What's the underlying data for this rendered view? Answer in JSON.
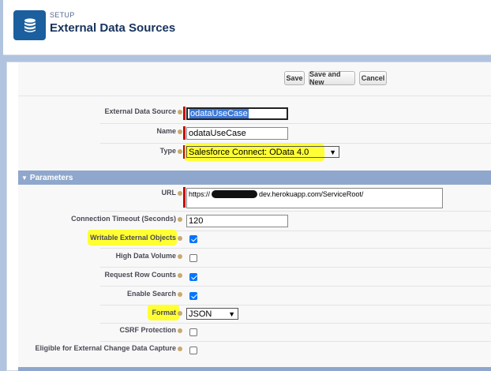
{
  "header": {
    "setup_label": "SETUP",
    "title": "External Data Sources",
    "icon": "database-icon",
    "icon_color": "#1b5f9e"
  },
  "toolbar": {
    "save": "Save",
    "save_and_new": "Save and New",
    "cancel": "Cancel"
  },
  "fields": {
    "external_data_source": {
      "label": "External Data Source",
      "value": "odataUseCase"
    },
    "name": {
      "label": "Name",
      "value": "odataUseCase"
    },
    "type": {
      "label": "Type",
      "value": "Salesforce Connect: OData 4.0"
    }
  },
  "parameters": {
    "section_title": "Parameters",
    "url": {
      "label": "URL",
      "value_prefix": "https://",
      "value_suffix": "dev.herokuapp.com/ServiceRoot/"
    },
    "connection_timeout": {
      "label": "Connection Timeout (Seconds)",
      "value": "120"
    },
    "writable_external_objects": {
      "label": "Writable External Objects",
      "checked": true
    },
    "high_data_volume": {
      "label": "High Data Volume",
      "checked": false
    },
    "request_row_counts": {
      "label": "Request Row Counts",
      "checked": true
    },
    "enable_search": {
      "label": "Enable Search",
      "checked": true
    },
    "format": {
      "label": "Format",
      "value": "JSON"
    },
    "csrf_protection": {
      "label": "CSRF Protection",
      "checked": false
    },
    "change_data_capture": {
      "label": "Eligible for External Change Data Capture",
      "checked": false
    }
  },
  "colors": {
    "section_header": "#8fa7cc",
    "highlight": "#ffff33",
    "required": "#cc0000"
  }
}
